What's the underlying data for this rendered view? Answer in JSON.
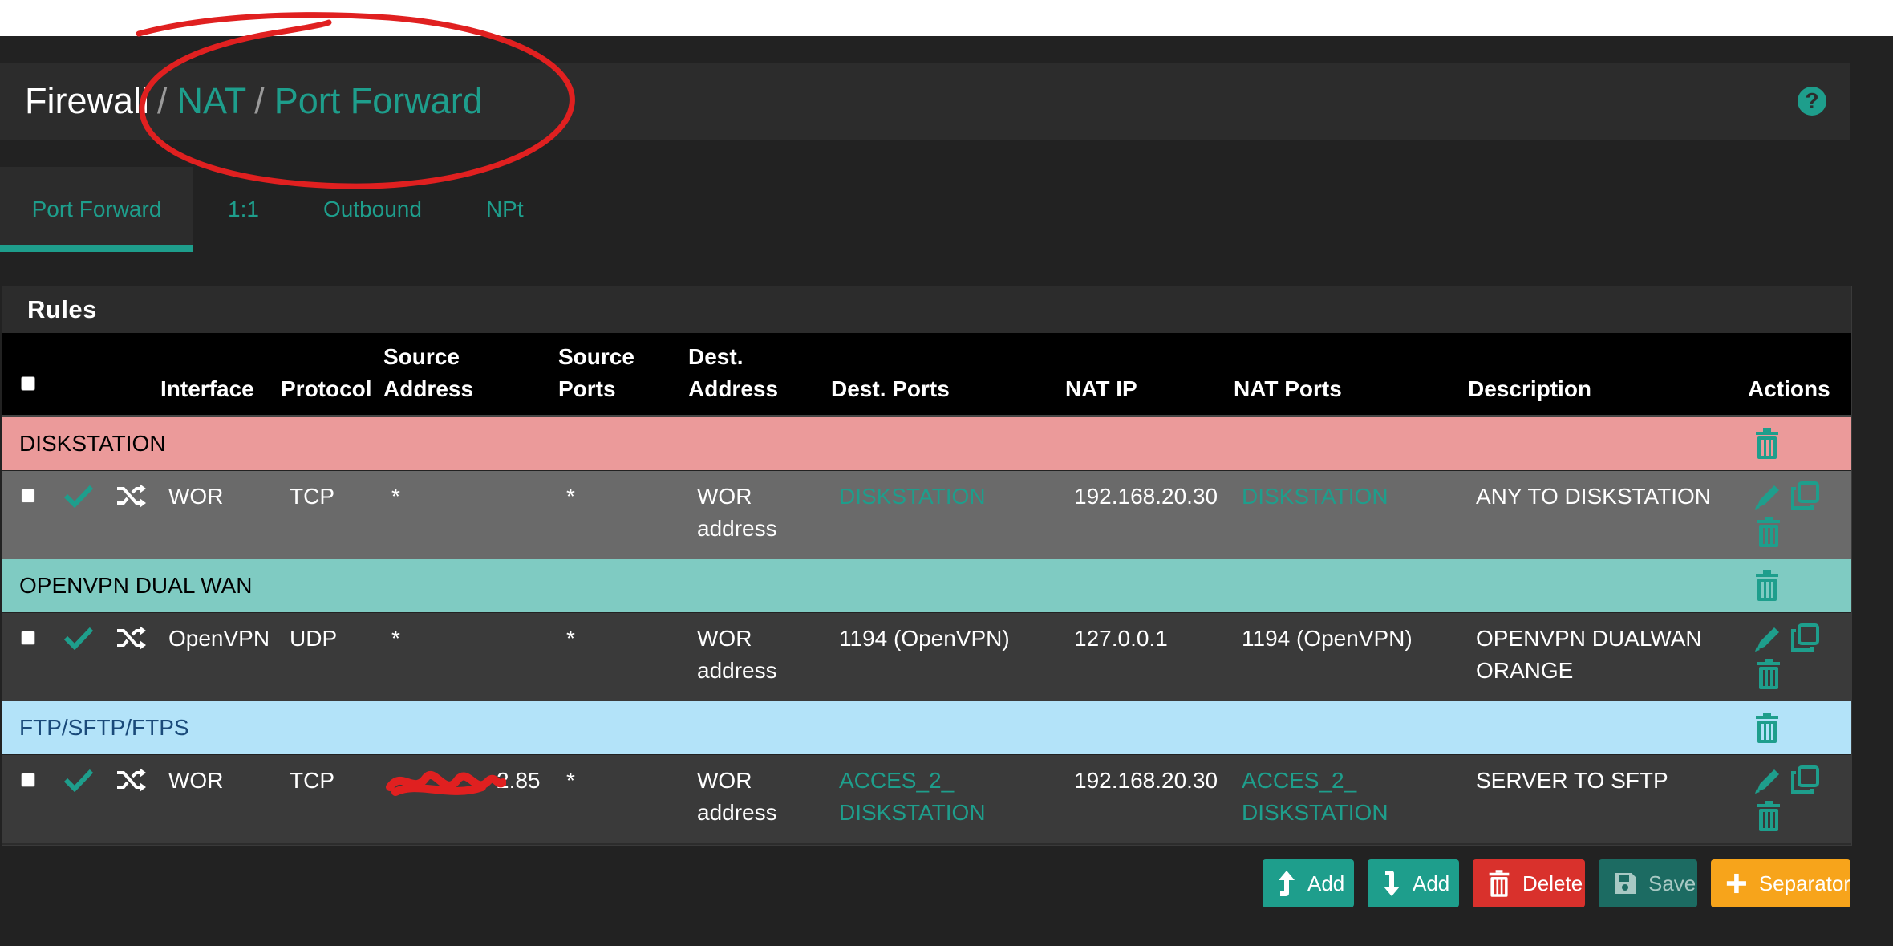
{
  "header": {
    "crumbs": [
      "Firewall",
      "NAT",
      "Port Forward"
    ],
    "separator": "/",
    "help": "?"
  },
  "tabs": [
    "Port Forward",
    "1:1",
    "Outbound",
    "NPt"
  ],
  "rules": {
    "title": "Rules",
    "columns": {
      "interface": "Interface",
      "protocol": "Protocol",
      "source_address": [
        "Source",
        "Address"
      ],
      "source_ports": [
        "Source",
        "Ports"
      ],
      "dest_address": [
        "Dest.",
        "Address"
      ],
      "dest_ports": "Dest. Ports",
      "nat_ip": "NAT IP",
      "nat_ports": "NAT Ports",
      "description": "Description",
      "actions": "Actions"
    },
    "groups": [
      {
        "label": "DISKSTATION",
        "color": "#eb9a9a",
        "text_color": "#000000",
        "row": {
          "interface": "WOR",
          "protocol": "TCP",
          "source_address": "*",
          "source_ports": "*",
          "dest_address": [
            "WOR",
            "address"
          ],
          "dest_ports": [
            "DISKSTATION"
          ],
          "nat_ip": "192.168.20.30",
          "nat_ports": [
            "DISKSTATION"
          ],
          "description": [
            "ANY TO DISKSTATION"
          ],
          "row_color": "#6a6a6a"
        }
      },
      {
        "label": "OPENVPN DUAL WAN",
        "color": "#7fcbc2",
        "text_color": "#000000",
        "row": {
          "interface": "OpenVPN",
          "protocol": "UDP",
          "source_address": "*",
          "source_ports": "*",
          "dest_address": [
            "WOR",
            "address"
          ],
          "dest_ports": [
            "1194 (OpenVPN)"
          ],
          "nat_ip": "127.0.0.1",
          "nat_ports": [
            "1194 (OpenVPN)"
          ],
          "description": [
            "OPENVPN DUALWAN",
            "ORANGE"
          ],
          "row_color": "#3a3a3a"
        }
      },
      {
        "label": "FTP/SFTP/FTPS",
        "color": "#b3e3f9",
        "text_color": "#1a4a7a",
        "row": {
          "interface": "WOR",
          "protocol": "TCP",
          "source_address": "2.85",
          "source_ports": "*",
          "dest_address": [
            "WOR",
            "address"
          ],
          "dest_ports": [
            "ACCES_2_",
            "DISKSTATION"
          ],
          "nat_ip": "192.168.20.30",
          "nat_ports": [
            "ACCES_2_",
            "DISKSTATION"
          ],
          "description": [
            "SERVER TO SFTP"
          ],
          "row_color": "#3a3a3a"
        }
      }
    ]
  },
  "buttons": {
    "add_top": "Add",
    "add_bottom": "Add",
    "delete": "Delete",
    "save": "Save",
    "separator": "Separator"
  },
  "colors": {
    "accent": "#1e9e8c",
    "danger": "#d9312c",
    "warning": "#f7a41b",
    "annotation": "#e02020"
  },
  "icons": {
    "enabled": "checkmark-icon",
    "nat_reflection": "shuffle-icon",
    "edit": "pencil-icon",
    "copy": "copy-icon",
    "delete": "trash-icon"
  }
}
